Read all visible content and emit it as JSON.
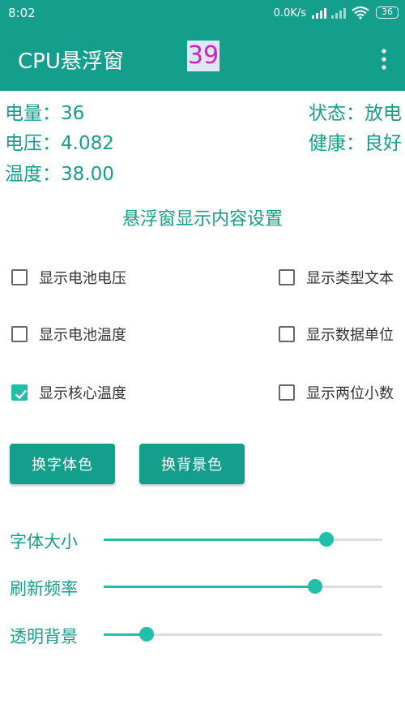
{
  "status_bar": {
    "time": "8:02",
    "net_speed": "0.0K/s",
    "battery_level": "36"
  },
  "toolbar": {
    "title": "CPU悬浮窗",
    "live_value": "39",
    "overflow_icon": "more-vert-icon"
  },
  "info": {
    "charge_label": "电量：",
    "charge_value": "36",
    "state_label": "状态：",
    "state_value": "放电",
    "voltage_label": "电压：",
    "voltage_value": "4.082",
    "health_label": "健康：",
    "health_value": "良好",
    "temp_label": "温度：",
    "temp_value": "38.00"
  },
  "settings": {
    "title": "悬浮窗显示内容设置",
    "options": [
      {
        "label": "显示电池电压",
        "checked": false
      },
      {
        "label": "显示类型文本",
        "checked": false
      },
      {
        "label": "显示电池温度",
        "checked": false
      },
      {
        "label": "显示数据单位",
        "checked": false
      },
      {
        "label": "显示核心温度",
        "checked": true
      },
      {
        "label": "显示两位小数",
        "checked": false
      }
    ]
  },
  "buttons": {
    "font_color": "换字体色",
    "bg_color": "换背景色"
  },
  "sliders": [
    {
      "label": "字体大小",
      "fraction": 0.8
    },
    {
      "label": "刷新频率",
      "fraction": 0.76
    },
    {
      "label": "透明背景",
      "fraction": 0.155
    }
  ],
  "colors": {
    "primary": "#139f8b",
    "accent": "#1fbfaa",
    "live_value_text": "#d11fc8"
  }
}
